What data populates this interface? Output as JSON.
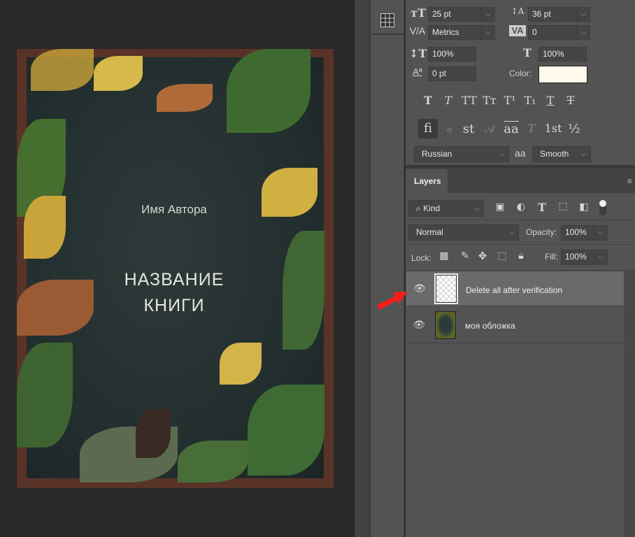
{
  "canvas": {
    "cover": {
      "author": "Имя Автора",
      "title_line1": "НАЗВАНИЕ",
      "title_line2": "КНИГИ"
    }
  },
  "dock": {
    "icon": "grid-icon"
  },
  "character": {
    "font_size": "25 pt",
    "leading": "36 pt",
    "kerning": "Metrics",
    "tracking": "0",
    "vertical_scale": "100%",
    "horizontal_scale": "100%",
    "baseline_shift": "0 pt",
    "color_label": "Color:",
    "color_value": "#fffaeb",
    "style_buttons": [
      "T",
      "T",
      "TT",
      "Tт",
      "T¹",
      "T₁",
      "T",
      "T"
    ],
    "opentype_buttons": [
      "fi",
      "ℴ",
      "st",
      "𝒜",
      "aa",
      "T",
      "1st",
      "½"
    ],
    "language": "Russian",
    "aa_icon": "aa",
    "antialias": "Smooth"
  },
  "layers": {
    "tab": "Layers",
    "filter_kind": "Kind",
    "blend_mode": "Normal",
    "opacity_label": "Opacity:",
    "opacity": "100%",
    "lock_label": "Lock:",
    "fill_label": "Fill:",
    "fill": "100%",
    "items": [
      {
        "name": "Delete all after verification",
        "selected": true,
        "visible": true
      },
      {
        "name": "моя обложка",
        "selected": false,
        "visible": true
      }
    ]
  },
  "colors": {
    "panel": "#535353",
    "canvas": "#282828",
    "selected_layer": "#6a6a6a",
    "annotation_arrow": "#ff1a1a"
  }
}
